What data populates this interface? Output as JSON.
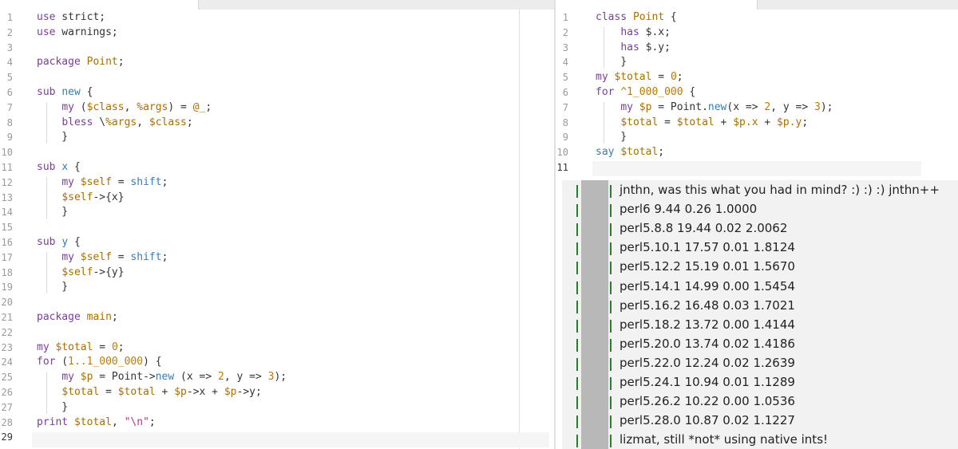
{
  "left_editor": {
    "lines": [
      "use strict;",
      "use warnings;",
      "",
      "package Point;",
      "",
      "sub new {",
      "    my ($class, %args) = @_;",
      "    bless \\%args, $class;",
      "    }",
      "",
      "sub x {",
      "    my $self = shift;",
      "    $self->{x}",
      "    }",
      "",
      "sub y {",
      "    my $self = shift;",
      "    $self->{y}",
      "    }",
      "",
      "package main;",
      "",
      "my $total = 0;",
      "for (1..1_000_000) {",
      "    my $p = Point->new (x => 2, y => 3);",
      "    $total = $total + $p->x + $p->y;",
      "    }",
      "print $total, \"\\n\";",
      ""
    ],
    "line_numbers": [
      "1",
      "2",
      "3",
      "4",
      "5",
      "6",
      "7",
      "8",
      "9",
      "10",
      "11",
      "12",
      "13",
      "14",
      "15",
      "16",
      "17",
      "18",
      "19",
      "20",
      "21",
      "22",
      "23",
      "24",
      "25",
      "26",
      "27",
      "28",
      "29"
    ]
  },
  "right_editor": {
    "lines": [
      "class Point {",
      "    has $.x;",
      "    has $.y;",
      "    }",
      "my $total = 0;",
      "for ^1_000_000 {",
      "    my $p = Point.new(x => 2, y => 3);",
      "    $total = $total + $p.x + $p.y;",
      "    }",
      "say $total;",
      ""
    ],
    "line_numbers": [
      "1",
      "2",
      "3",
      "4",
      "5",
      "6",
      "7",
      "8",
      "9",
      "10",
      "11"
    ]
  },
  "irc_log": {
    "messages": [
      "jnthn, was this what you had in mind? :) :) :) jnthn++",
      "perl6 9.44 0.26 1.0000",
      "perl5.8.8 19.44 0.02 2.0062",
      "perl5.10.1 17.57 0.01 1.8124",
      "perl5.12.2 15.19 0.01 1.5670",
      "perl5.14.1 14.99 0.00 1.5454",
      "perl5.16.2 16.48 0.03 1.7021",
      "perl5.18.2 13.72 0.00 1.4144",
      "perl5.20.0 13.74 0.02 1.4186",
      "perl5.22.0 12.24 0.02 1.2639",
      "perl5.24.1 10.94 0.01 1.1289",
      "perl5.26.2 10.22 0.00 1.0536",
      "perl5.28.0 10.87 0.02 1.1227",
      "lizmat, still *not* using native ints!"
    ]
  }
}
